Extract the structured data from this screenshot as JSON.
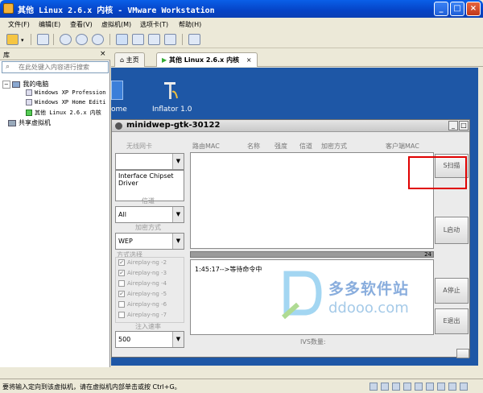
{
  "window": {
    "title": "其他 Linux 2.6.x 内核 - VMware Workstation"
  },
  "menu": {
    "items": [
      "文件(F)",
      "编辑(E)",
      "查看(V)",
      "虚拟机(M)",
      "选项卡(T)",
      "帮助(H)"
    ]
  },
  "sidebar": {
    "title": "库",
    "close": "×",
    "search_placeholder": "在此处键入内容进行搜索",
    "tree": {
      "root": "我的电脑",
      "vms": [
        "Windows XP Profession",
        "Windows XP Home Editi",
        "其他 Linux 2.6.x 内核"
      ],
      "shared": "共享虚拟机"
    }
  },
  "tabs": {
    "home": "主页",
    "vm": "其他 Linux 2.6.x 内核",
    "close": "×"
  },
  "desktop": {
    "icon1_label": "ome",
    "icon2_label": "Inflator 1.0"
  },
  "minidwep": {
    "title": "minidwep-gtk-30122",
    "wireless_label": "无线网卡",
    "interface_chipset": "Interface Chipset",
    "driver": "Driver",
    "channel_label": "信道",
    "channel_value": "All",
    "encryption_label": "加密方式",
    "encryption_value": "WEP",
    "method_label": "方式选择",
    "methods": [
      {
        "label": "Aireplay-ng -2",
        "checked": true
      },
      {
        "label": "Aireplay-ng -3",
        "checked": true
      },
      {
        "label": "Aireplay-ng -4",
        "checked": false
      },
      {
        "label": "Aireplay-ng -5",
        "checked": true
      },
      {
        "label": "Aireplay-ng -6",
        "checked": false
      },
      {
        "label": "Aireplay-ng -7",
        "checked": false
      }
    ],
    "inject_label": "注入速率",
    "inject_value": "500",
    "columns": [
      "路由MAC",
      "名称",
      "强度",
      "信道",
      "加密方式",
      "客户端MAC"
    ],
    "progress_value": "24",
    "log_text": "1:45:17-->等待命令中",
    "ivs_label": "IVS数量:",
    "buttons": {
      "scan": "S扫描",
      "launch": "L启动",
      "stop": "A停止",
      "exit": "E退出"
    }
  },
  "watermark": {
    "text": "多多软件站",
    "url": "ddooo.com"
  },
  "status": {
    "text": "要将输入定向到该虚拟机，请在虚拟机内部单击或按 Ctrl+G。"
  },
  "colors": {
    "highlight_box": "#e00000",
    "vm_background": "#1e57a6",
    "titlebar": "#0543c6"
  }
}
